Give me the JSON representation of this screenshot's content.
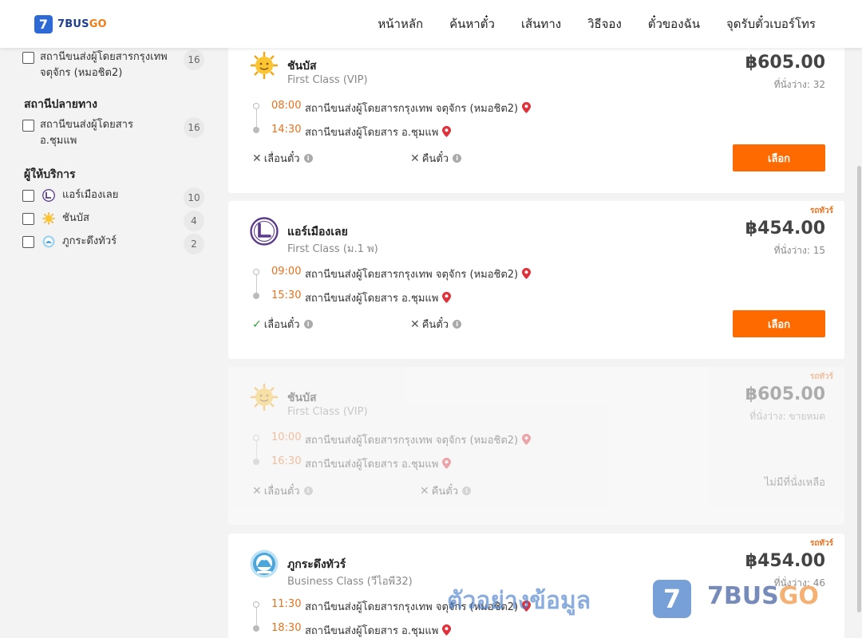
{
  "header": {
    "logo_badge": "7",
    "logo_text_a": "7BUS",
    "logo_text_b": "GO",
    "nav": [
      "หน้าหลัก",
      "ค้นหาตั๋ว",
      "เส้นทาง",
      "วิธีจอง",
      "ตั๋วของฉัน",
      "จุดรับตั๋วเบอร์โทร"
    ]
  },
  "sidebar": {
    "origin_item": {
      "label": "สถานีขนส่งผู้โดยสารกรุงเทพ จตุจักร (หมอชิต2)",
      "count": "16"
    },
    "destination_heading": "สถานีปลายทาง",
    "destination_item": {
      "label": "สถานีขนส่งผู้โดยสาร อ.ชุมแพ",
      "count": "16"
    },
    "operator_heading": "ผู้ให้บริการ",
    "operators": [
      {
        "label": "แอร์เมืองเลย",
        "count": "10",
        "icon": "air-muang-loei-icon"
      },
      {
        "label": "ชันบัส",
        "count": "4",
        "icon": "sun-icon"
      },
      {
        "label": "ภูกระดึงทัวร์",
        "count": "2",
        "icon": "phukradueng-icon"
      }
    ]
  },
  "results": [
    {
      "operator": "ชันบัส",
      "bus_class": "First Class (VIP)",
      "price": "฿605.00",
      "seats": "ที่นั่งว่าง: 32",
      "tag": "",
      "depart_time": "08:00",
      "depart_station": "สถานีขนส่งผู้โดยสารกรุงเทพ จตุจักร (หมอชิต2)",
      "arrive_time": "14:30",
      "arrive_station": "สถานีขนส่งผู้โดยสาร อ.ชุมแพ",
      "reschedule": "เลื่อนตั๋ว",
      "refund": "คืนตั๋ว",
      "button": "เลือก"
    },
    {
      "operator": "แอร์เมืองเลย",
      "bus_class": "First Class (ม.1 พ)",
      "price": "฿454.00",
      "seats": "ที่นั่งว่าง: 15",
      "tag": "รถทัวร์",
      "depart_time": "09:00",
      "depart_station": "สถานีขนส่งผู้โดยสารกรุงเทพ จตุจักร (หมอชิต2)",
      "arrive_time": "15:30",
      "arrive_station": "สถานีขนส่งผู้โดยสาร อ.ชุมแพ",
      "reschedule": "เลื่อนตั๋ว",
      "refund": "คืนตั๋ว",
      "button": "เลือก"
    },
    {
      "operator": "ชันบัส",
      "bus_class": "First Class (VIP)",
      "price": "฿605.00",
      "seats": "ที่นั่งว่าง: ขายหมด",
      "tag": "รถทัวร์",
      "depart_time": "10:00",
      "depart_station": "สถานีขนส่งผู้โดยสารกรุงเทพ จตุจักร (หมอชิต2)",
      "arrive_time": "16:30",
      "arrive_station": "สถานีขนส่งผู้โดยสาร อ.ชุมแพ",
      "reschedule": "เลื่อนตั๋ว",
      "refund": "คืนตั๋ว",
      "soldout_note": "ไม่มีที่นั่งเหลือ"
    },
    {
      "operator": "ภูกระดึงทัวร์",
      "bus_class": "Business Class (วีไอพี32)",
      "price": "฿454.00",
      "seats": "ที่นั่งว่าง: 46",
      "tag": "รถทัวร์",
      "depart_time": "11:30",
      "depart_station": "สถานีขนส่งผู้โดยสารกรุงเทพ จตุจักร (หมอชิต2)",
      "arrive_time": "18:30",
      "arrive_station": "สถานีขนส่งผู้โดยสาร อ.ชุมแพ"
    }
  ],
  "watermark": {
    "text": "ตัวอย่างข้อมูล",
    "badge": "7",
    "brand_a": "7BUS",
    "brand_b": "GO"
  },
  "colors": {
    "accent": "#ff6a00",
    "time": "#e8711c",
    "brand_blue": "#2e6ad6",
    "pin": "#e0303a"
  }
}
